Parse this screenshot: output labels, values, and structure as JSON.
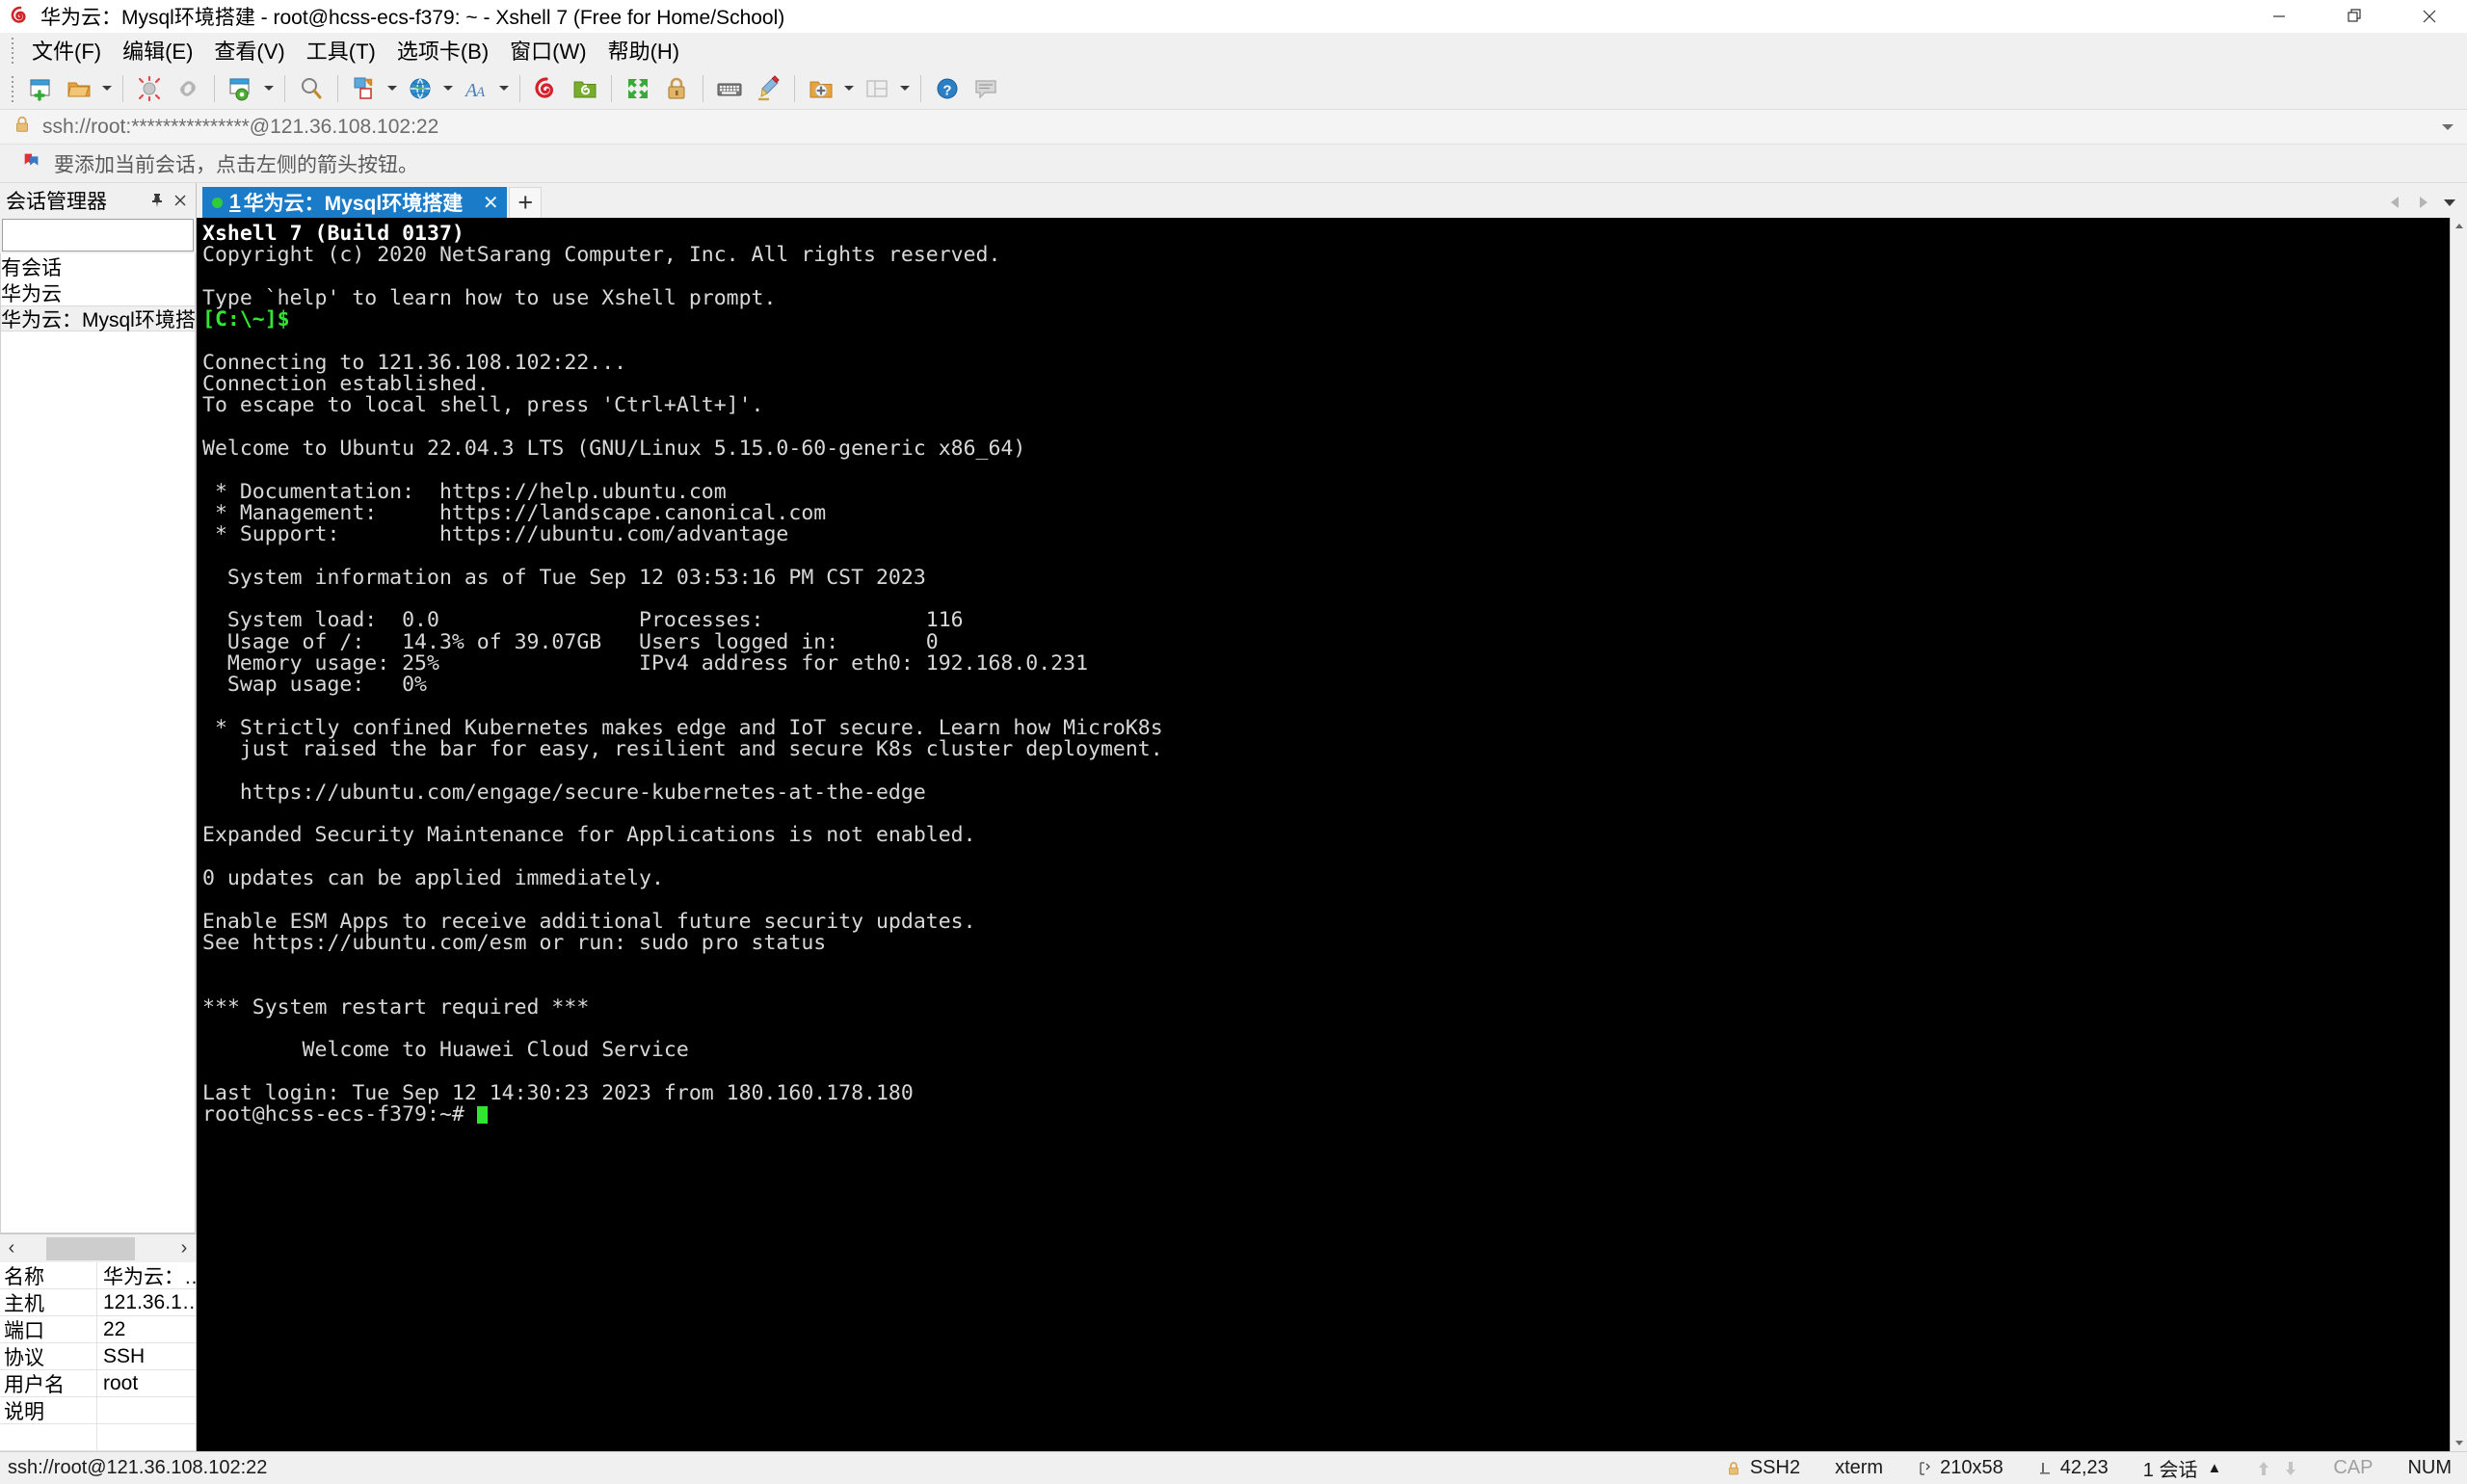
{
  "window": {
    "title": "华为云：Mysql环境搭建 - root@hcss-ecs-f379: ~ - Xshell 7 (Free for Home/School)",
    "app_icon": "xshell-spiral-icon",
    "minimize_label": "最小化",
    "restore_label": "还原",
    "close_label": "关闭"
  },
  "menubar": {
    "items": [
      {
        "label": "文件(F)",
        "name": "menu-file"
      },
      {
        "label": "编辑(E)",
        "name": "menu-edit"
      },
      {
        "label": "查看(V)",
        "name": "menu-view"
      },
      {
        "label": "工具(T)",
        "name": "menu-tools"
      },
      {
        "label": "选项卡(B)",
        "name": "menu-tabs"
      },
      {
        "label": "窗口(W)",
        "name": "menu-window"
      },
      {
        "label": "帮助(H)",
        "name": "menu-help"
      }
    ]
  },
  "toolbar": {
    "buttons": [
      {
        "name": "new-session-icon",
        "tip": "新建会话"
      },
      {
        "name": "open-session-icon",
        "tip": "打开会话"
      },
      {
        "name": "disconnect-icon",
        "tip": "断开"
      },
      {
        "name": "reconnect-icon",
        "tip": "重新连接"
      },
      {
        "name": "session-properties-icon",
        "tip": "属性"
      },
      {
        "name": "find-icon",
        "tip": "查找"
      },
      {
        "name": "file-transfer-icon",
        "tip": "文件传输"
      },
      {
        "name": "globe-icon",
        "tip": "编码"
      },
      {
        "name": "font-icon",
        "tip": "字体"
      },
      {
        "name": "xshell-icon",
        "tip": "Xshell"
      },
      {
        "name": "xftp-icon",
        "tip": "Xftp"
      },
      {
        "name": "fullscreen-icon",
        "tip": "全屏"
      },
      {
        "name": "lock-icon",
        "tip": "锁定"
      },
      {
        "name": "keyboard-icon",
        "tip": "键盘"
      },
      {
        "name": "highlight-icon",
        "tip": "高亮"
      },
      {
        "name": "add-folder-icon",
        "tip": "新建文件夹"
      },
      {
        "name": "layout-icon",
        "tip": "布局"
      },
      {
        "name": "help-icon",
        "tip": "帮助"
      },
      {
        "name": "comment-icon",
        "tip": "注释"
      }
    ]
  },
  "address_bar": {
    "icon": "lock-icon",
    "value": "ssh://root:***************@121.36.108.102:22",
    "dropdown_icon": "chevron-down-icon"
  },
  "notice_bar": {
    "icon": "bookmark-flag-icon",
    "text": "要添加当前会话，点击左侧的箭头按钮。"
  },
  "session_manager": {
    "title": "会话管理器",
    "pin_icon": "pin-icon",
    "close_icon": "close-icon",
    "search": {
      "value": "",
      "placeholder": "",
      "icon": "search-icon"
    },
    "tree": [
      {
        "label": "有会话",
        "name": "tree-item-all-sessions",
        "selected": false
      },
      {
        "label": "华为云",
        "name": "tree-item-huawei-cloud",
        "selected": false
      },
      {
        "label": "华为云：Mysql环境搭建",
        "name": "tree-item-mysql-env",
        "selected": true
      }
    ],
    "hscroll": {
      "left_icon": "chevron-left-icon",
      "right_icon": "chevron-right-icon"
    },
    "properties": [
      {
        "key": "名称",
        "value": "华为云：…"
      },
      {
        "key": "主机",
        "value": "121.36.1…"
      },
      {
        "key": "端口",
        "value": "22"
      },
      {
        "key": "协议",
        "value": "SSH"
      },
      {
        "key": "用户名",
        "value": "root"
      },
      {
        "key": "说明",
        "value": ""
      },
      {
        "key": "",
        "value": ""
      }
    ]
  },
  "tabs": {
    "items": [
      {
        "number": "1",
        "label": "华为云：Mysql环境搭建",
        "status": "connected",
        "close_icon": "close-icon"
      }
    ],
    "add_label": "+",
    "scroll_left_icon": "chevron-left-icon",
    "scroll_right_icon": "chevron-right-icon",
    "menu_icon": "chevron-down-icon"
  },
  "terminal": {
    "lines": [
      {
        "t": "Xshell 7 (Build 0137)",
        "c": "w"
      },
      {
        "t": "Copyright (c) 2020 NetSarang Computer, Inc. All rights reserved."
      },
      {
        "t": ""
      },
      {
        "t": "Type `help' to learn how to use Xshell prompt."
      },
      {
        "t": "[C:\\~]$",
        "c": "g"
      },
      {
        "t": ""
      },
      {
        "t": "Connecting to 121.36.108.102:22..."
      },
      {
        "t": "Connection established."
      },
      {
        "t": "To escape to local shell, press 'Ctrl+Alt+]'."
      },
      {
        "t": ""
      },
      {
        "t": "Welcome to Ubuntu 22.04.3 LTS (GNU/Linux 5.15.0-60-generic x86_64)"
      },
      {
        "t": ""
      },
      {
        "t": " * Documentation:  https://help.ubuntu.com"
      },
      {
        "t": " * Management:     https://landscape.canonical.com"
      },
      {
        "t": " * Support:        https://ubuntu.com/advantage"
      },
      {
        "t": ""
      },
      {
        "t": "  System information as of Tue Sep 12 03:53:16 PM CST 2023"
      },
      {
        "t": ""
      },
      {
        "t": "  System load:  0.0                Processes:             116"
      },
      {
        "t": "  Usage of /:   14.3% of 39.07GB   Users logged in:       0"
      },
      {
        "t": "  Memory usage: 25%                IPv4 address for eth0: 192.168.0.231"
      },
      {
        "t": "  Swap usage:   0%"
      },
      {
        "t": ""
      },
      {
        "t": " * Strictly confined Kubernetes makes edge and IoT secure. Learn how MicroK8s"
      },
      {
        "t": "   just raised the bar for easy, resilient and secure K8s cluster deployment."
      },
      {
        "t": ""
      },
      {
        "t": "   https://ubuntu.com/engage/secure-kubernetes-at-the-edge"
      },
      {
        "t": ""
      },
      {
        "t": "Expanded Security Maintenance for Applications is not enabled."
      },
      {
        "t": ""
      },
      {
        "t": "0 updates can be applied immediately."
      },
      {
        "t": ""
      },
      {
        "t": "Enable ESM Apps to receive additional future security updates."
      },
      {
        "t": "See https://ubuntu.com/esm or run: sudo pro status"
      },
      {
        "t": ""
      },
      {
        "t": ""
      },
      {
        "t": "*** System restart required ***"
      },
      {
        "t": ""
      },
      {
        "t": "        Welcome to Huawei Cloud Service"
      },
      {
        "t": ""
      },
      {
        "t": "Last login: Tue Sep 12 14:30:23 2023 from 180.160.178.180"
      }
    ],
    "prompt": "root@hcss-ecs-f379:~# ",
    "colors": {
      "background": "#000000",
      "foreground": "#d8d8d8",
      "green": "#31e531"
    }
  },
  "statusbar": {
    "left": "ssh://root@121.36.108.102:22",
    "security_icon": "lock-icon",
    "protocol": "SSH2",
    "terminal_type": "xterm",
    "size_icon": "resize-icon",
    "size": "210x58",
    "cursor_icon": "cursor-icon",
    "cursor": "42,23",
    "sessions": "1 会话",
    "sessions_caret": "▲",
    "upload_icon": "arrow-up-icon",
    "download_icon": "arrow-down-icon",
    "caps": "CAP",
    "num": "NUM"
  }
}
